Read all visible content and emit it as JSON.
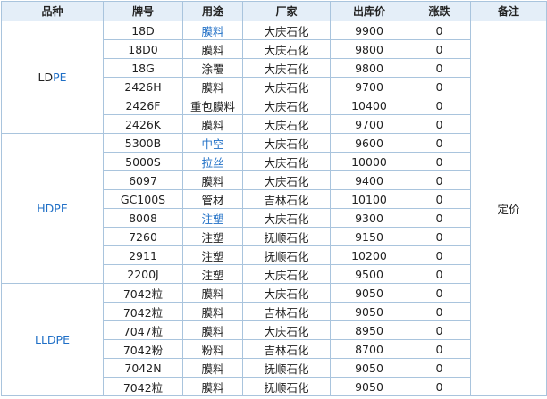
{
  "table": {
    "headers": [
      "品种",
      "牌号",
      "用途",
      "厂家",
      "出库价",
      "涨跌",
      "备注"
    ],
    "note": "定价",
    "groups": [
      {
        "name_prefix": "LD",
        "name_suffix": "PE",
        "rows": [
          {
            "grade": "18D",
            "use": "膜料",
            "use_link": true,
            "factory": "大庆石化",
            "price": "9900",
            "change": "0"
          },
          {
            "grade": "18D0",
            "use": "膜料",
            "use_link": false,
            "factory": "大庆石化",
            "price": "9800",
            "change": "0"
          },
          {
            "grade": "18G",
            "use": "涂覆",
            "use_link": false,
            "factory": "大庆石化",
            "price": "9800",
            "change": "0"
          },
          {
            "grade": "2426H",
            "use": "膜料",
            "use_link": false,
            "factory": "大庆石化",
            "price": "9700",
            "change": "0"
          },
          {
            "grade": "2426F",
            "use": "重包膜料",
            "use_link": false,
            "factory": "大庆石化",
            "price": "10400",
            "change": "0"
          },
          {
            "grade": "2426K",
            "use": "膜料",
            "use_link": false,
            "factory": "大庆石化",
            "price": "9700",
            "change": "0"
          }
        ]
      },
      {
        "name_prefix": "",
        "name_suffix": "HDPE",
        "rows": [
          {
            "grade": "5300B",
            "use": "中空",
            "use_link": true,
            "factory": "大庆石化",
            "price": "9600",
            "change": "0"
          },
          {
            "grade": "5000S",
            "use": "拉丝",
            "use_link": true,
            "factory": "大庆石化",
            "price": "10000",
            "change": "0"
          },
          {
            "grade": "6097",
            "use": "膜料",
            "use_link": false,
            "factory": "大庆石化",
            "price": "9400",
            "change": "0"
          },
          {
            "grade": "GC100S",
            "use": "管材",
            "use_link": false,
            "factory": "吉林石化",
            "price": "10100",
            "change": "0"
          },
          {
            "grade": "8008",
            "use": "注塑",
            "use_link": true,
            "factory": "大庆石化",
            "price": "9300",
            "change": "0"
          },
          {
            "grade": "7260",
            "use": "注塑",
            "use_link": false,
            "factory": "抚顺石化",
            "price": "9150",
            "change": "0"
          },
          {
            "grade": "2911",
            "use": "注塑",
            "use_link": false,
            "factory": "抚顺石化",
            "price": "10200",
            "change": "0"
          },
          {
            "grade": "2200J",
            "use": "注塑",
            "use_link": false,
            "factory": "大庆石化",
            "price": "9500",
            "change": "0"
          }
        ]
      },
      {
        "name_prefix": "",
        "name_suffix": "LLDPE",
        "rows": [
          {
            "grade": "7042粒",
            "use": "膜料",
            "use_link": false,
            "factory": "大庆石化",
            "price": "9050",
            "change": "0"
          },
          {
            "grade": "7042粒",
            "use": "膜料",
            "use_link": false,
            "factory": "吉林石化",
            "price": "9050",
            "change": "0"
          },
          {
            "grade": "7047粒",
            "use": "膜料",
            "use_link": false,
            "factory": "大庆石化",
            "price": "8950",
            "change": "0"
          },
          {
            "grade": "7042粉",
            "use": "粉料",
            "use_link": false,
            "factory": "吉林石化",
            "price": "8700",
            "change": "0"
          },
          {
            "grade": "7042N",
            "use": "膜料",
            "use_link": false,
            "factory": "抚顺石化",
            "price": "9050",
            "change": "0"
          },
          {
            "grade": "7042粒",
            "use": "膜料",
            "use_link": false,
            "factory": "抚顺石化",
            "price": "9050",
            "change": "0"
          }
        ]
      }
    ]
  },
  "colors": {
    "border": "#a9c4dd",
    "header_bg": "#e4eef8",
    "link_blue": "#1f6fc6",
    "text": "#222222"
  }
}
